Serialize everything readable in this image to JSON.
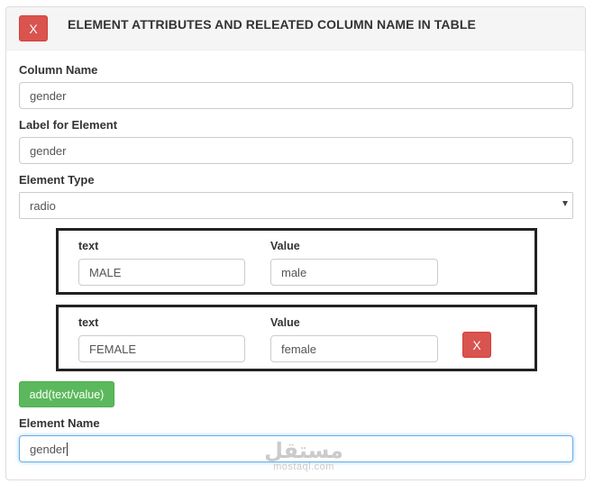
{
  "panel": {
    "title": "ELEMENT ATTRIBUTES AND RELEATED COLUMN NAME IN TABLE",
    "close_label": "X"
  },
  "form": {
    "column_name": {
      "label": "Column Name",
      "value": "gender"
    },
    "label_for_element": {
      "label": "Label for Element",
      "value": "gender"
    },
    "element_type": {
      "label": "Element Type",
      "selected": "radio"
    },
    "options": [
      {
        "text_label": "text",
        "value_label": "Value",
        "text": "MALE",
        "value": "male"
      },
      {
        "text_label": "text",
        "value_label": "Value",
        "text": "FEMALE",
        "value": "female",
        "remove_label": "X"
      }
    ],
    "add_button_label": "add(text/value)",
    "element_name": {
      "label": "Element Name",
      "value": "gender"
    }
  },
  "watermark": {
    "logo_text": "مستقل",
    "site": "mostaql.com"
  },
  "colors": {
    "danger": "#d9534f",
    "success": "#5cb85c",
    "focus_border": "#66afe9"
  }
}
